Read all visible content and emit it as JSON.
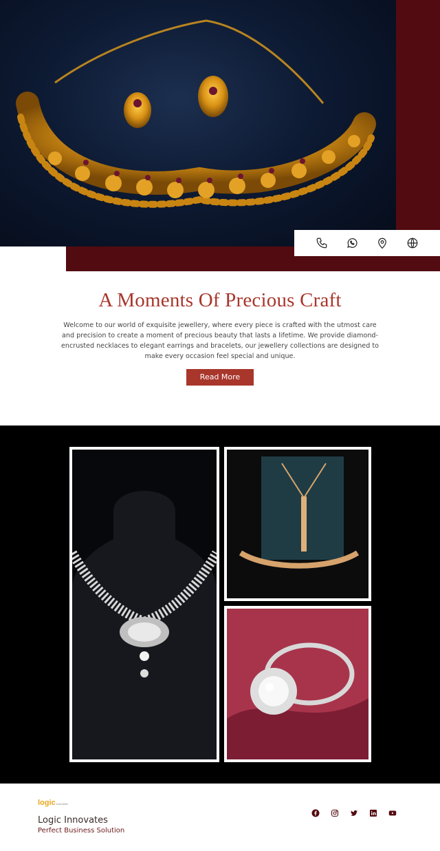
{
  "hero": {
    "image_alt": "Gold necklace and earrings on dark blue background",
    "contact_icons": [
      "phone-icon",
      "whatsapp-icon",
      "location-pin-icon",
      "globe-icon"
    ]
  },
  "intro": {
    "title": "A Moments Of Precious Craft",
    "body": "Welcome to our world of exquisite jewellery, where every piece is crafted with the utmost care and precision to create a moment of precious beauty that lasts a lifetime. We provide diamond-encrusted necklaces to elegant earrings and bracelets, our jewellery collections are designed to make every occasion feel special and unique.",
    "button_label": "Read More"
  },
  "gallery": {
    "images": [
      "Diamond necklace on black bust",
      "Gold pendant and bracelet with teal box",
      "Diamond ring on red satin"
    ]
  },
  "footer": {
    "logo_word": "logic",
    "logo_sub": "innovates",
    "company": "Logic Innovates",
    "tagline": "Perfect Business Solution",
    "social_icons": [
      "facebook-icon",
      "instagram-icon",
      "twitter-icon",
      "linkedin-icon",
      "youtube-icon"
    ]
  },
  "colors": {
    "maroon": "#520b10",
    "accent": "#a8362b",
    "logo": "#e8a81c"
  }
}
